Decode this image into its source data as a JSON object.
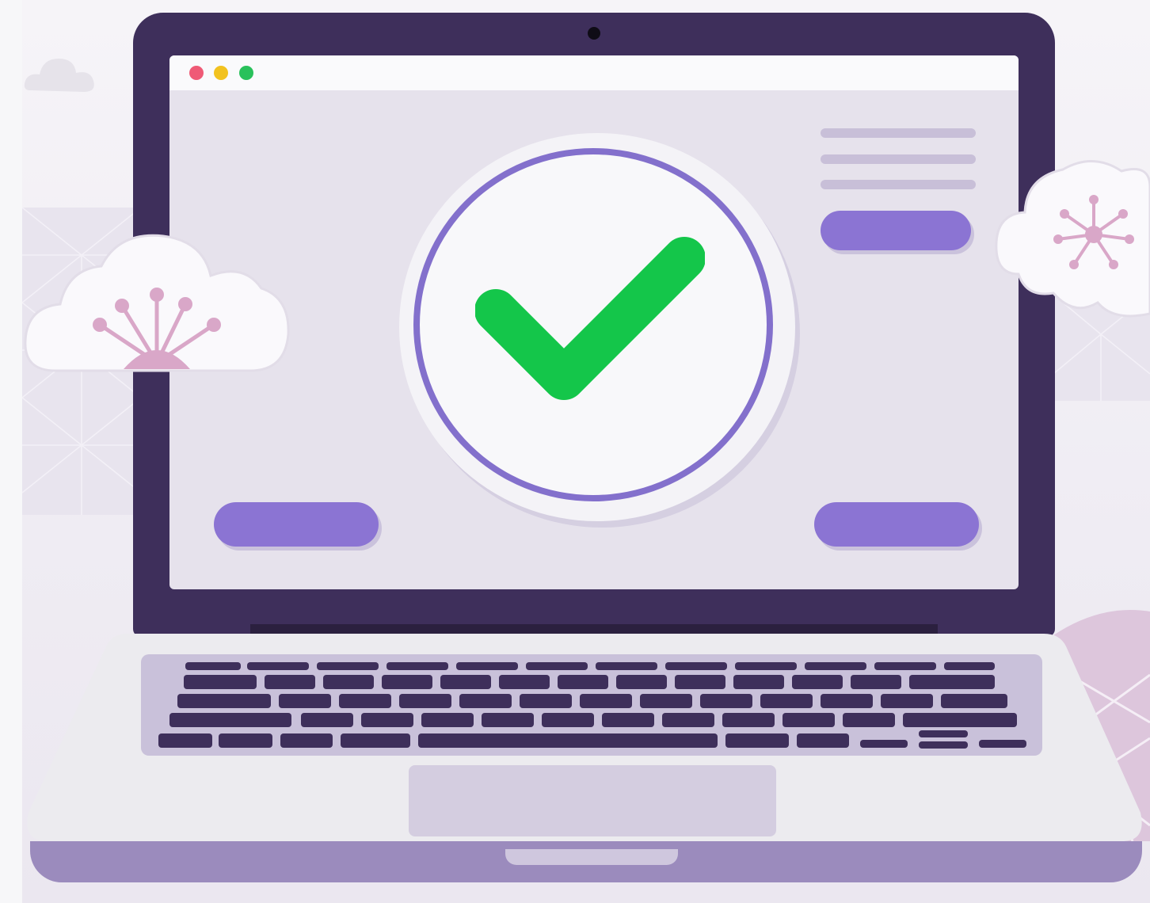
{
  "scene": {
    "colors": {
      "lid": "#3e2f5b",
      "screen": "#e6e2ec",
      "accent_purple": "#8b74d3",
      "ring": "#8370cc",
      "check_green": "#14c64a",
      "flower_pink": "#d9a7c8"
    },
    "window_controls": [
      "close-dot",
      "minimize-dot",
      "maximize-dot"
    ],
    "icons": [
      "checkmark-icon",
      "flower-icon",
      "asterisk-flower-icon"
    ]
  }
}
